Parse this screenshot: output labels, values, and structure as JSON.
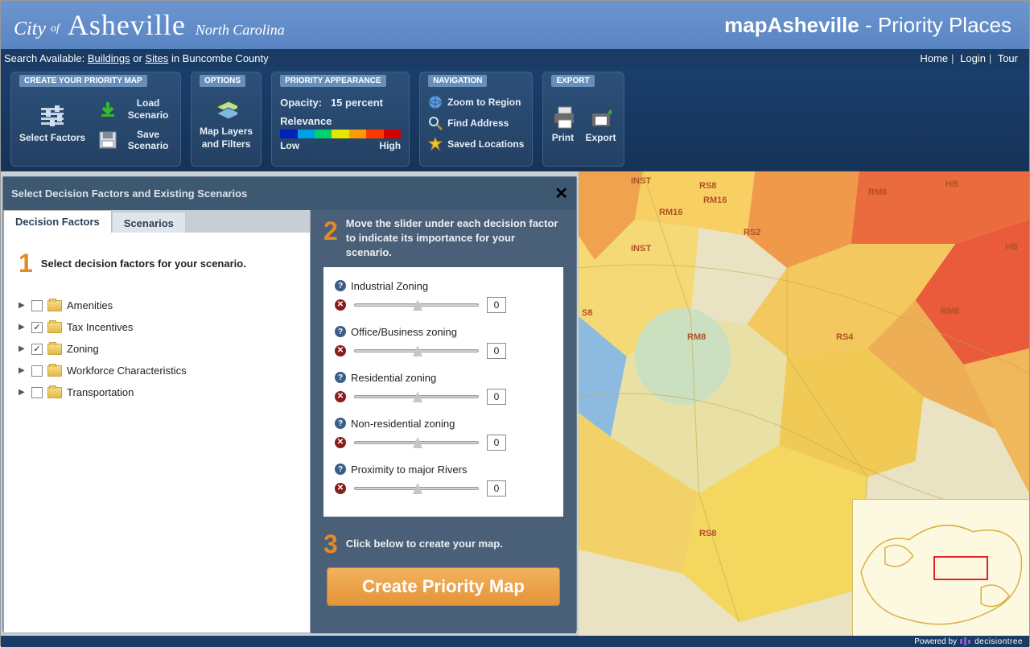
{
  "header": {
    "logo_city": "City",
    "logo_of": "of",
    "logo_main": "Asheville",
    "logo_sub": "North Carolina",
    "app_title_bold": "mapAsheville",
    "app_title_rest": " - Priority Places"
  },
  "subbar": {
    "search_label": "Search Available: ",
    "link_buildings": "Buildings",
    "or": " or ",
    "link_sites": "Sites",
    "rest": " in Buncombe County",
    "nav_home": "Home",
    "nav_login": "Login",
    "nav_tour": "Tour"
  },
  "ribbon": {
    "create": {
      "title": "CREATE YOUR PRIORITY MAP",
      "select_factors": "Select Factors",
      "load_scenario": "Load Scenario",
      "save_scenario": "Save Scenario"
    },
    "options": {
      "title": "OPTIONS",
      "maplayers_l1": "Map Layers",
      "maplayers_l2": "and Filters"
    },
    "appearance": {
      "title": "PRIORITY APPEARANCE",
      "opacity_label": "Opacity:",
      "opacity_value": "15 percent",
      "relevance_label": "Relevance",
      "low": "Low",
      "high": "High",
      "colors": [
        "#0021b5",
        "#009ee8",
        "#00d36a",
        "#e5e700",
        "#ff9b00",
        "#ff3800",
        "#d30000"
      ]
    },
    "navigation": {
      "title": "NAVIGATION",
      "zoom": "Zoom to Region",
      "find": "Find Address",
      "saved": "Saved Locations"
    },
    "export": {
      "title": "EXPORT",
      "print": "Print",
      "export": "Export"
    }
  },
  "dialog": {
    "title": "Select Decision Factors and Existing Scenarios",
    "tab_factors": "Decision Factors",
    "tab_scenarios": "Scenarios",
    "step1_num": "1",
    "step1_text": "Select decision factors for your scenario.",
    "tree": [
      {
        "label": "Amenities",
        "checked": false
      },
      {
        "label": "Tax Incentives",
        "checked": true
      },
      {
        "label": "Zoning",
        "checked": true
      },
      {
        "label": "Workforce Characteristics",
        "checked": false
      },
      {
        "label": "Transportation",
        "checked": false
      }
    ],
    "step2_num": "2",
    "step2_text": "Move the slider under each decision factor to indicate its importance for your scenario.",
    "factors": [
      {
        "name": "Industrial Zoning",
        "value": "0"
      },
      {
        "name": "Office/Business zoning",
        "value": "0"
      },
      {
        "name": "Residential zoning",
        "value": "0"
      },
      {
        "name": "Non-residential zoning",
        "value": "0"
      },
      {
        "name": "Proximity to major Rivers",
        "value": "0"
      }
    ],
    "step3_num": "3",
    "step3_text": "Click below to create your map.",
    "create_btn": "Create Priority Map"
  },
  "map_labels": [
    "INST",
    "RS8",
    "RM16",
    "RM16",
    "RS2",
    "RM6",
    "HB",
    "HB",
    "INST",
    "S8",
    "RM8",
    "RM8",
    "RS4",
    "RS8"
  ],
  "footer": {
    "powered": "Powered by",
    "brand": "decisiontree"
  }
}
